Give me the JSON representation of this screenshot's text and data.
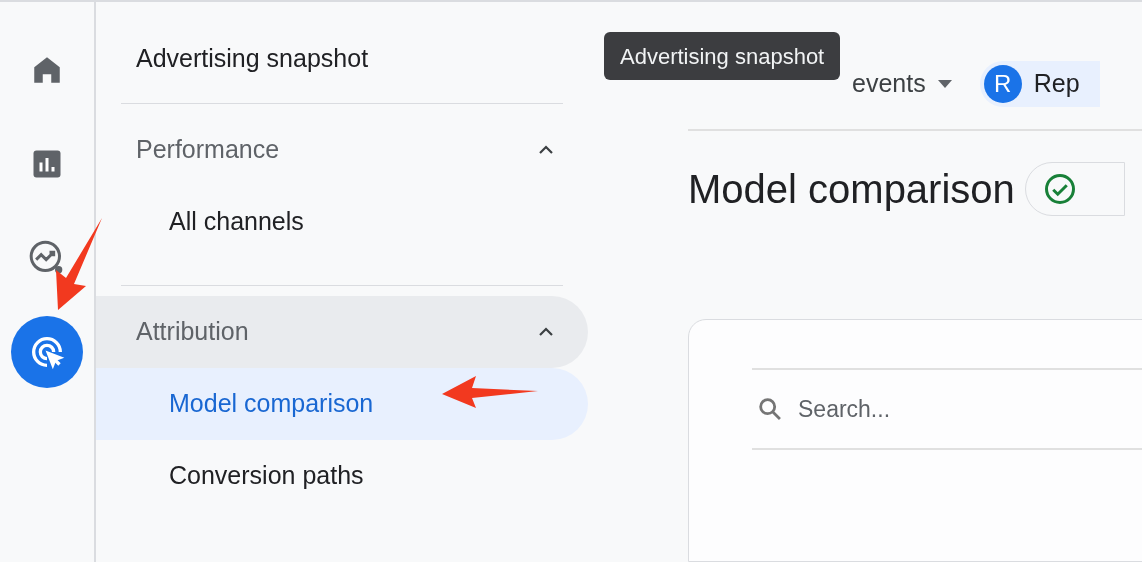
{
  "rail": [
    {
      "kind": "home",
      "selected": false
    },
    {
      "kind": "reports",
      "selected": false
    },
    {
      "kind": "explore",
      "selected": false
    },
    {
      "kind": "advertising",
      "selected": true
    }
  ],
  "nav": {
    "title": "Advertising snapshot",
    "sections": [
      {
        "label": "Performance",
        "expanded": true,
        "hovered": false,
        "items": [
          {
            "label": "All channels",
            "selected": false
          }
        ]
      },
      {
        "label": "Attribution",
        "expanded": true,
        "hovered": true,
        "items": [
          {
            "label": "Model comparison",
            "selected": true
          },
          {
            "label": "Conversion paths",
            "selected": false
          }
        ]
      }
    ]
  },
  "tooltip": "Advertising snapshot",
  "toolbar": {
    "conversion_events": "events",
    "chip_initial": "R",
    "chip_label": "Rep"
  },
  "page_title": "Model comparison",
  "search": {
    "placeholder": "Search..."
  }
}
